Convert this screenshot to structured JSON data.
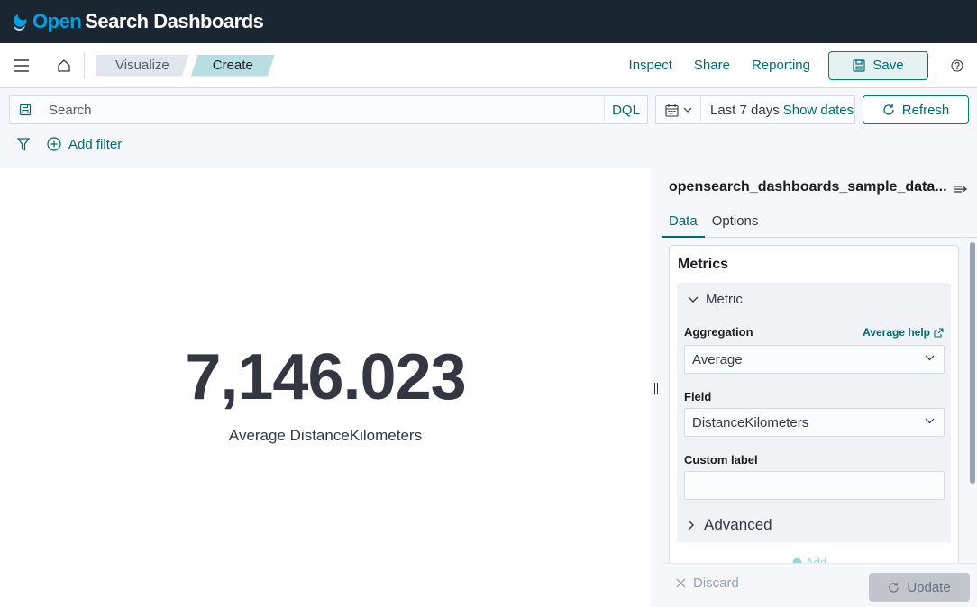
{
  "brand": {
    "open": "Open",
    "rest": "Search Dashboards"
  },
  "nav": {
    "breadcrumbs": [
      "Visualize",
      "Create"
    ],
    "links": {
      "inspect": "Inspect",
      "share": "Share",
      "reporting": "Reporting"
    },
    "save_label": "Save"
  },
  "query": {
    "placeholder": "Search",
    "language": "DQL"
  },
  "time": {
    "range": "Last 7 days",
    "show_dates": "Show dates",
    "refresh_label": "Refresh"
  },
  "filters": {
    "add_label": "Add filter"
  },
  "visualization": {
    "value": "7,146.023",
    "label": "Average DistanceKilometers"
  },
  "panel": {
    "title": "opensearch_dashboards_sample_data...",
    "tabs": [
      "Data",
      "Options"
    ],
    "metrics_heading": "Metrics",
    "metric_title": "Metric",
    "aggregation_label": "Aggregation",
    "aggregation_help": "Average help",
    "aggregation_value": "Average",
    "field_label": "Field",
    "field_value": "DistanceKilometers",
    "custom_label": "Custom label",
    "custom_value": "",
    "advanced_label": "Advanced",
    "add_label": "Add",
    "discard_label": "Discard",
    "update_label": "Update"
  },
  "colors": {
    "header_bg": "#1a2733",
    "accent": "#006b6e",
    "brand_blue": "#00a3e0"
  }
}
